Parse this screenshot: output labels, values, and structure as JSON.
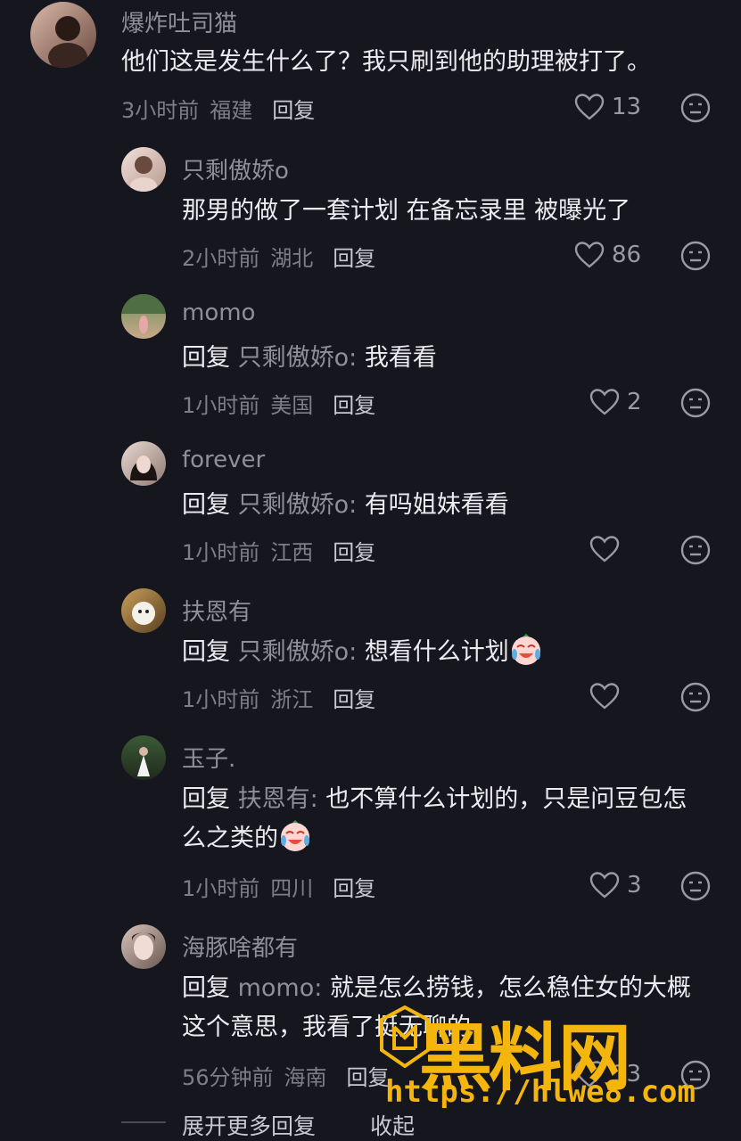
{
  "comments": [
    {
      "username": "爆炸吐司猫",
      "text": "他们这是发生什么了？我只刷到他的助理被打了。",
      "time": "3小时前",
      "location": "福建",
      "reply_label": "回复",
      "likes": "13"
    },
    {
      "username": "只剩傲娇o",
      "text": "那男的做了一套计划 在备忘录里 被曝光了",
      "time": "2小时前",
      "location": "湖北",
      "reply_label": "回复",
      "likes": "86"
    },
    {
      "username": "momo",
      "reply_prefix": "回复",
      "reply_target": "只剩傲娇o:",
      "text": "我看看",
      "time": "1小时前",
      "location": "美国",
      "reply_label": "回复",
      "likes": "2"
    },
    {
      "username": "forever",
      "reply_prefix": "回复",
      "reply_target": "只剩傲娇o:",
      "text": "有吗姐妹看看",
      "time": "1小时前",
      "location": "江西",
      "reply_label": "回复",
      "likes": ""
    },
    {
      "username": "扶恩有",
      "reply_prefix": "回复",
      "reply_target": "只剩傲娇o:",
      "text": "想看什么计划",
      "time": "1小时前",
      "location": "浙江",
      "reply_label": "回复",
      "likes": ""
    },
    {
      "username": "玉子.",
      "reply_prefix": "回复",
      "reply_target": "扶恩有:",
      "text": "也不算什么计划的，只是问豆包怎么之类的",
      "time": "1小时前",
      "location": "四川",
      "reply_label": "回复",
      "likes": "3"
    },
    {
      "username": "海豚啥都有",
      "reply_prefix": "回复",
      "reply_target": "momo:",
      "text": "就是怎么捞钱，怎么稳住女的大概这个意思，我看了挺无聊的",
      "time": "56分钟前",
      "location": "海南",
      "reply_label": "回复",
      "likes": "13"
    }
  ],
  "footer": {
    "more_replies": "展开更多回复",
    "collapse": "收起"
  },
  "watermark": {
    "text": "黑料网",
    "url": "https://hlwe8.com"
  },
  "icons": {
    "like": "heart-outline-icon",
    "dislike": "neutral-face-icon",
    "emoji": "crying-laughing-emoji"
  },
  "colors": {
    "background": "#16161e",
    "watermark": "#f4b60c"
  }
}
